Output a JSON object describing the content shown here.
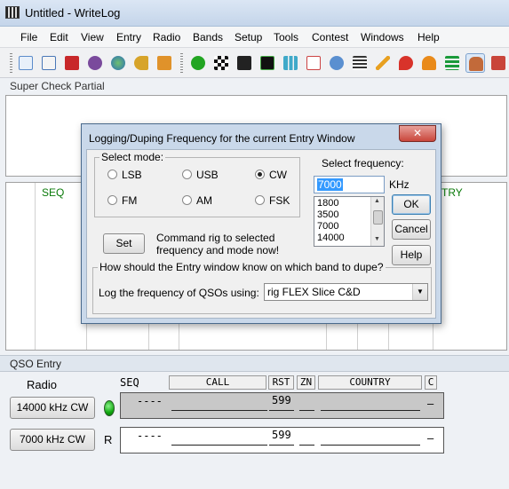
{
  "window": {
    "title": "Untitled - WriteLog"
  },
  "menu": [
    "File",
    "Edit",
    "View",
    "Entry",
    "Radio",
    "Bands",
    "Setup",
    "Tools",
    "Contest",
    "Windows",
    "Help"
  ],
  "toolbar": {
    "icons": [
      "new-icon",
      "edit-icon",
      "save-icon",
      "ram-icon",
      "globe-icon",
      "key-icon",
      "briefcase-icon",
      "crosshair-icon",
      "checker-icon",
      "radio-icon",
      "display-icon",
      "bar-chart-icon",
      "calendar-icon",
      "compass-icon",
      "list-icon",
      "pencil-icon",
      "map-pin-icon",
      "cloud-icon",
      "chevrons-icon",
      "person-icon",
      "tower-icon"
    ]
  },
  "super_check": {
    "label": "Super Check Partial"
  },
  "grid": {
    "headers": [
      "SEQ",
      "TRY"
    ]
  },
  "qso_entry": {
    "label": "QSO Entry",
    "radio_label": "Radio",
    "radio1_button": "14000 kHz CW",
    "radio2_button": "7000 kHz CW",
    "radio2_letter": "R",
    "columns": {
      "seq": "SEQ",
      "call": "CALL",
      "rst": "RST",
      "zn": "ZN",
      "country": "COUNTRY",
      "c": "C"
    },
    "row1": {
      "seq": "----",
      "rst": "599",
      "c": "–"
    },
    "row2": {
      "seq": "----",
      "rst": "599",
      "c": "–"
    }
  },
  "dialog": {
    "title": "Logging/Duping Frequency for the current Entry Window",
    "close": "✕",
    "mode_legend": "Select mode:",
    "modes": [
      {
        "label": "LSB",
        "checked": false
      },
      {
        "label": "USB",
        "checked": false
      },
      {
        "label": "CW",
        "checked": true
      },
      {
        "label": "FM",
        "checked": false
      },
      {
        "label": "AM",
        "checked": false
      },
      {
        "label": "FSK",
        "checked": false
      }
    ],
    "set_button": "Set",
    "set_desc": "Command rig to selected frequency and mode now!",
    "select_freq_label": "Select frequency:",
    "freq_value": "7000",
    "khz": "KHz",
    "freq_options": [
      "1800",
      "3500",
      "7000",
      "14000"
    ],
    "ok": "OK",
    "cancel": "Cancel",
    "help": "Help",
    "band_legend": "How should the Entry window know on which band to dupe?",
    "log_label": "Log the frequency of QSOs using:",
    "band_select_value": "rig FLEX Slice C&D",
    "band_select_arrow": "▼"
  },
  "colors": {
    "accent_green": "#0a7a0a",
    "dialog_frame": "#c9d8ea",
    "close_red": "#c9463b",
    "selection": "#3399ff"
  }
}
